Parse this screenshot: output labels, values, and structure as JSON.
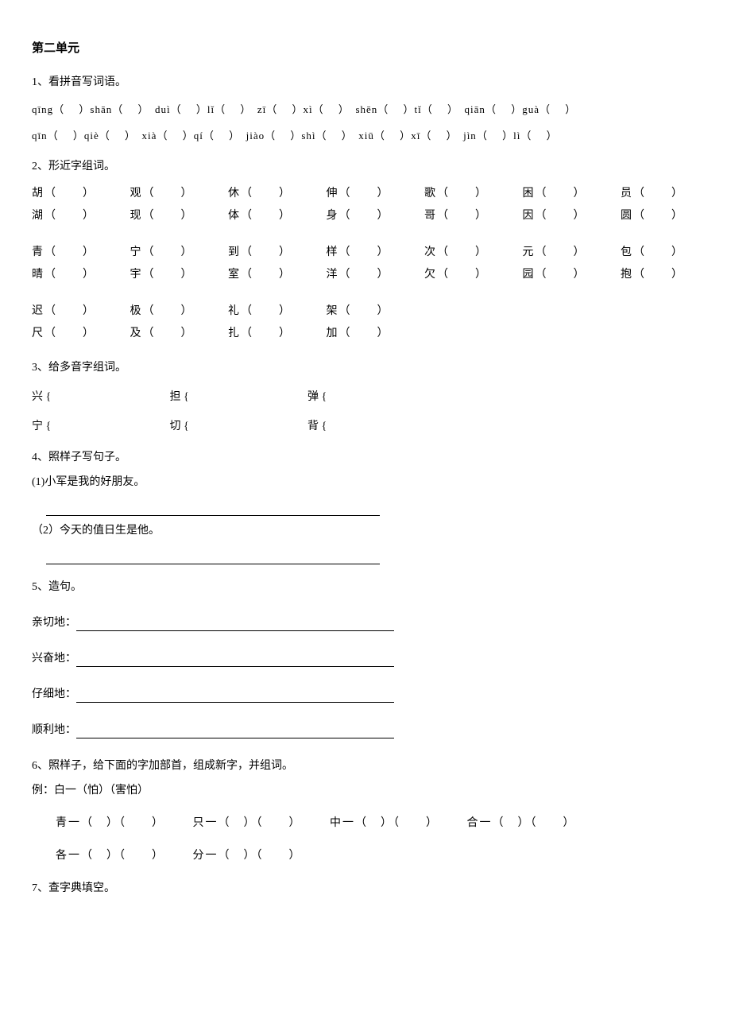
{
  "title": "第二单元",
  "q1": {
    "head": "1、看拼音写词语。",
    "row1": [
      "qīng",
      "shān",
      "duì",
      "lǐ",
      "zī",
      "xì",
      "shēn",
      "tǐ",
      "qiān",
      "guà"
    ],
    "row2": [
      "qīn",
      "qiè",
      "xià",
      "qí",
      "jiào",
      "shì",
      "xiū",
      "xī",
      "jìn",
      "lì"
    ]
  },
  "q2": {
    "head": "2、形近字组词。",
    "group1": [
      [
        "胡",
        "观",
        "休",
        "伸",
        "歌",
        "困",
        "员"
      ],
      [
        "湖",
        "现",
        "体",
        "身",
        "哥",
        "因",
        "圆"
      ]
    ],
    "group2": [
      [
        "青",
        "宁",
        "到",
        "样",
        "次",
        "元",
        "包"
      ],
      [
        "晴",
        "宇",
        "室",
        "洋",
        "欠",
        "园",
        "抱"
      ]
    ],
    "group3": [
      [
        "迟",
        "极",
        "礼",
        "架"
      ],
      [
        "尺",
        "及",
        "扎",
        "加"
      ]
    ]
  },
  "q3": {
    "head": "3、给多音字组词。",
    "row1": [
      "兴",
      "担",
      "弹"
    ],
    "row2": [
      "宁",
      "切",
      "背"
    ]
  },
  "q4": {
    "head": "4、照样子写句子。",
    "item1": "(1)小军是我的好朋友。",
    "item2": "（2）今天的值日生是他。"
  },
  "q5": {
    "head": "5、造句。",
    "items": [
      "亲切地：",
      "兴奋地：",
      "仔细地：",
      "顺利地："
    ]
  },
  "q6": {
    "head": "6、照样子，给下面的字加部首，组成新字，并组词。",
    "example": "例：白一（怕）（害怕）",
    "row1": [
      "青一",
      "只一",
      "中一",
      "合一"
    ],
    "row2": [
      "各一",
      "分一"
    ]
  },
  "q7": {
    "head": "7、查字典填空。"
  },
  "paren": "（　　）",
  "paren_s": "（　）",
  "brace": " {"
}
